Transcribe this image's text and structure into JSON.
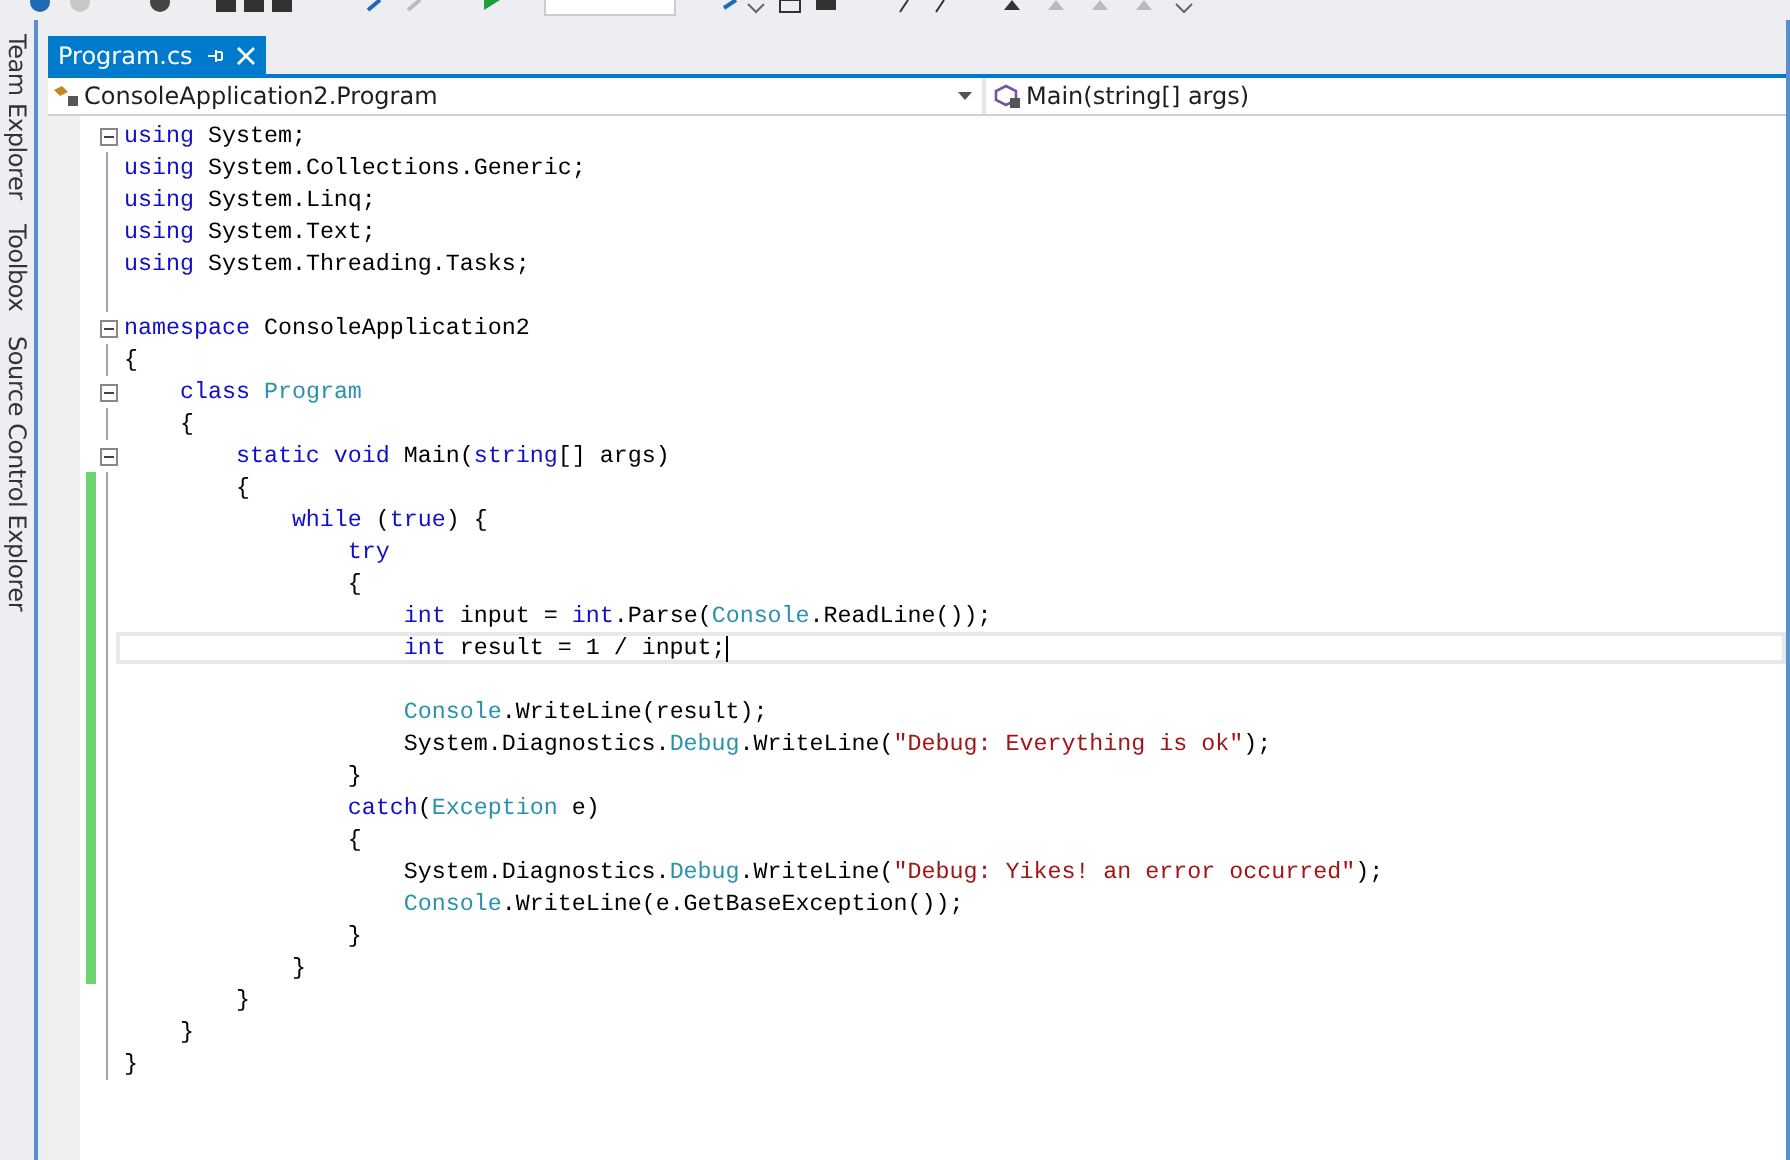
{
  "side_tabs": [
    {
      "label": "Team Explorer"
    },
    {
      "label": "Toolbox"
    },
    {
      "label": "Source Control Explorer"
    }
  ],
  "document_tabs": [
    {
      "label": "Program.cs",
      "selected": true
    }
  ],
  "navigation_bar": {
    "type_dropdown": "ConsoleApplication2.Program",
    "member_dropdown": "Main(string[] args)"
  },
  "code": {
    "lines": [
      {
        "collapsible": true,
        "changed": false,
        "current": false,
        "tokens": [
          {
            "kind": "keyword",
            "text": "using"
          },
          {
            "kind": "plain",
            "text": " System;"
          }
        ]
      },
      {
        "collapsible": false,
        "changed": false,
        "current": false,
        "tokens": [
          {
            "kind": "keyword",
            "text": "using"
          },
          {
            "kind": "plain",
            "text": " System.Collections.Generic;"
          }
        ]
      },
      {
        "collapsible": false,
        "changed": false,
        "current": false,
        "tokens": [
          {
            "kind": "keyword",
            "text": "using"
          },
          {
            "kind": "plain",
            "text": " System.Linq;"
          }
        ]
      },
      {
        "collapsible": false,
        "changed": false,
        "current": false,
        "tokens": [
          {
            "kind": "keyword",
            "text": "using"
          },
          {
            "kind": "plain",
            "text": " System.Text;"
          }
        ]
      },
      {
        "collapsible": false,
        "changed": false,
        "current": false,
        "tokens": [
          {
            "kind": "keyword",
            "text": "using"
          },
          {
            "kind": "plain",
            "text": " System.Threading.Tasks;"
          }
        ]
      },
      {
        "collapsible": false,
        "changed": false,
        "current": false
      },
      {
        "collapsible": true,
        "changed": false,
        "current": false,
        "tokens": [
          {
            "kind": "keyword",
            "text": "namespace"
          },
          {
            "kind": "plain",
            "text": " ConsoleApplication2"
          }
        ]
      },
      {
        "collapsible": false,
        "changed": false,
        "current": false,
        "tokens": [
          {
            "kind": "plain",
            "text": "{"
          }
        ]
      },
      {
        "collapsible": true,
        "changed": false,
        "current": false,
        "tokens": [
          {
            "kind": "keyword",
            "text": "    class"
          },
          {
            "kind": "type",
            "text": " Program"
          }
        ]
      },
      {
        "collapsible": false,
        "changed": false,
        "current": false,
        "tokens": [
          {
            "kind": "plain",
            "text": "    {"
          }
        ]
      },
      {
        "collapsible": true,
        "changed": false,
        "current": false,
        "tokens": [
          {
            "kind": "keyword",
            "text": "        static void"
          },
          {
            "kind": "plain",
            "text": " Main("
          },
          {
            "kind": "keyword",
            "text": "string"
          },
          {
            "kind": "plain",
            "text": "[] args)"
          }
        ]
      },
      {
        "collapsible": false,
        "changed": true,
        "current": false,
        "tokens": [
          {
            "kind": "plain",
            "text": "        {"
          }
        ]
      },
      {
        "collapsible": false,
        "changed": true,
        "current": false,
        "tokens": [
          {
            "kind": "keyword",
            "text": "            while"
          },
          {
            "kind": "plain",
            "text": " ("
          },
          {
            "kind": "keyword",
            "text": "true"
          },
          {
            "kind": "plain",
            "text": ") {"
          }
        ]
      },
      {
        "collapsible": false,
        "changed": true,
        "current": false,
        "tokens": [
          {
            "kind": "keyword",
            "text": "                try"
          }
        ]
      },
      {
        "collapsible": false,
        "changed": true,
        "current": false,
        "tokens": [
          {
            "kind": "plain",
            "text": "                {"
          }
        ]
      },
      {
        "collapsible": false,
        "changed": true,
        "current": false,
        "tokens": [
          {
            "kind": "keyword",
            "text": "                    int"
          },
          {
            "kind": "plain",
            "text": " input = "
          },
          {
            "kind": "keyword",
            "text": "int"
          },
          {
            "kind": "plain",
            "text": ".Parse("
          },
          {
            "kind": "type",
            "text": "Console"
          },
          {
            "kind": "plain",
            "text": ".ReadLine());"
          }
        ]
      },
      {
        "collapsible": false,
        "changed": true,
        "current": true,
        "tokens": [
          {
            "kind": "keyword",
            "text": "                    int"
          },
          {
            "kind": "plain",
            "text": " result = 1 / input;"
          }
        ]
      },
      {
        "collapsible": false,
        "changed": true,
        "current": false
      },
      {
        "collapsible": false,
        "changed": true,
        "current": false,
        "tokens": [
          {
            "kind": "type",
            "text": "                    Console"
          },
          {
            "kind": "plain",
            "text": ".WriteLine(result);"
          }
        ]
      },
      {
        "collapsible": false,
        "changed": true,
        "current": false,
        "tokens": [
          {
            "kind": "plain",
            "text": "                    System.Diagnostics."
          },
          {
            "kind": "type",
            "text": "Debug"
          },
          {
            "kind": "plain",
            "text": ".WriteLine("
          },
          {
            "kind": "string",
            "text": "\"Debug: Everything is ok\""
          },
          {
            "kind": "plain",
            "text": ");"
          }
        ]
      },
      {
        "collapsible": false,
        "changed": true,
        "current": false,
        "tokens": [
          {
            "kind": "plain",
            "text": "                }"
          }
        ]
      },
      {
        "collapsible": false,
        "changed": true,
        "current": false,
        "tokens": [
          {
            "kind": "keyword",
            "text": "                catch"
          },
          {
            "kind": "plain",
            "text": "("
          },
          {
            "kind": "type",
            "text": "Exception"
          },
          {
            "kind": "plain",
            "text": " e)"
          }
        ]
      },
      {
        "collapsible": false,
        "changed": true,
        "current": false,
        "tokens": [
          {
            "kind": "plain",
            "text": "                {"
          }
        ]
      },
      {
        "collapsible": false,
        "changed": true,
        "current": false,
        "tokens": [
          {
            "kind": "plain",
            "text": "                    System.Diagnostics."
          },
          {
            "kind": "type",
            "text": "Debug"
          },
          {
            "kind": "plain",
            "text": ".WriteLine("
          },
          {
            "kind": "string",
            "text": "\"Debug: Yikes! an error occurred\""
          },
          {
            "kind": "plain",
            "text": ");"
          }
        ]
      },
      {
        "collapsible": false,
        "changed": true,
        "current": false,
        "tokens": [
          {
            "kind": "type",
            "text": "                    Console"
          },
          {
            "kind": "plain",
            "text": ".WriteLine(e.GetBaseException());"
          }
        ]
      },
      {
        "collapsible": false,
        "changed": true,
        "current": false,
        "tokens": [
          {
            "kind": "plain",
            "text": "                }"
          }
        ]
      },
      {
        "collapsible": false,
        "changed": true,
        "current": false,
        "tokens": [
          {
            "kind": "plain",
            "text": "            }"
          }
        ]
      },
      {
        "collapsible": false,
        "changed": false,
        "current": false,
        "tokens": [
          {
            "kind": "plain",
            "text": "        }"
          }
        ]
      },
      {
        "collapsible": false,
        "changed": false,
        "current": false,
        "tokens": [
          {
            "kind": "plain",
            "text": "    }"
          }
        ]
      },
      {
        "collapsible": false,
        "changed": false,
        "current": false,
        "tokens": [
          {
            "kind": "plain",
            "text": "}"
          }
        ]
      }
    ]
  }
}
